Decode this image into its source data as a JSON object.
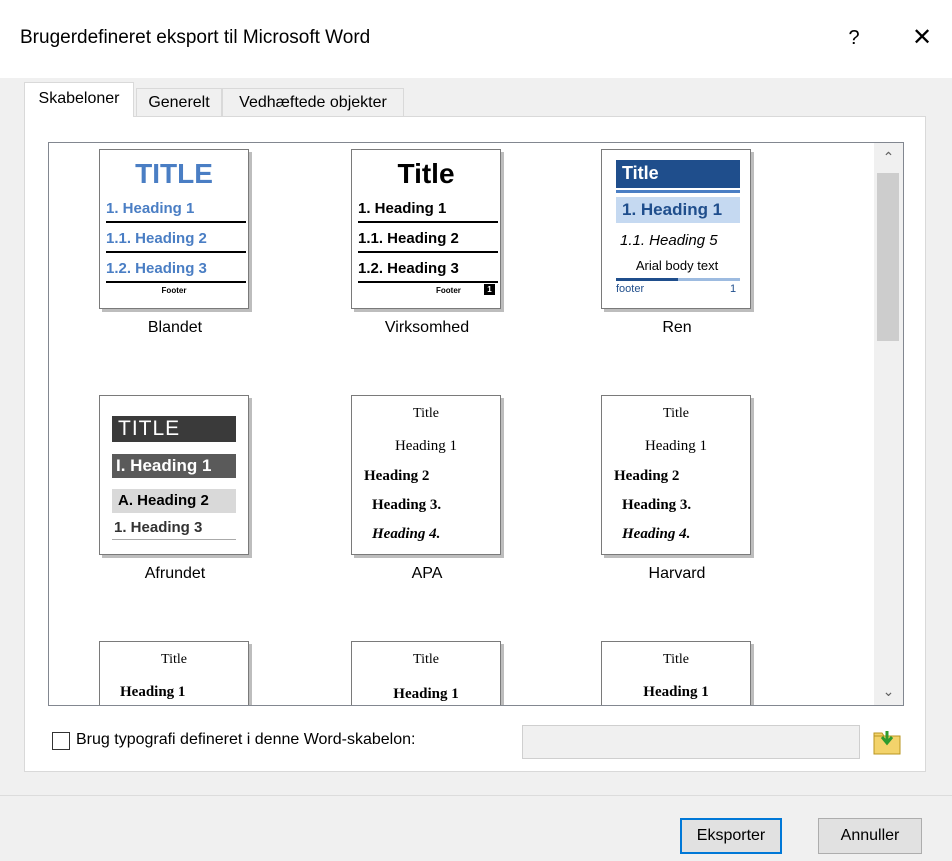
{
  "window": {
    "title": "Brugerdefineret eksport til Microsoft Word",
    "help": "?",
    "close": "✕"
  },
  "tabs": [
    "Skabeloner",
    "Generelt",
    "Vedhæftede objekter"
  ],
  "templates": [
    {
      "name": "Blandet",
      "title": "TITLE",
      "h1": "1. Heading 1",
      "h2": "1.1. Heading 2",
      "h3": "1.2. Heading 3",
      "footer": "Footer"
    },
    {
      "name": "Virksomhed",
      "title": "Title",
      "h1": "1. Heading 1",
      "h2": "1.1. Heading 2",
      "h3": "1.2. Heading 3",
      "footer": "Footer",
      "page": "1"
    },
    {
      "name": "Ren",
      "title": "Title",
      "h1": "1. Heading 1",
      "h5": "1.1. Heading 5",
      "body": "Arial body text",
      "footer": "footer",
      "page": "1"
    },
    {
      "name": "Afrundet",
      "title": "TITLE",
      "h1": "I. Heading 1",
      "h2": "A. Heading 2",
      "h3": "1. Heading 3"
    },
    {
      "name": "APA",
      "title": "Title",
      "h1": "Heading 1",
      "h2": "Heading 2",
      "h3": "Heading 3.",
      "h4": "Heading 4."
    },
    {
      "name": "Harvard",
      "title": "Title",
      "h1": "Heading 1",
      "h2": "Heading 2",
      "h3": "Heading 3.",
      "h4": "Heading 4."
    },
    {
      "title": "Title",
      "h1": "Heading 1"
    },
    {
      "title": "Title",
      "h1": "Heading 1"
    },
    {
      "title": "Title",
      "h1": "Heading 1"
    }
  ],
  "use_template_style": {
    "label": "Brug typografi defineret i denne Word-skabelon:",
    "checked": false,
    "path": ""
  },
  "buttons": {
    "export": "Eksporter",
    "cancel": "Annuller"
  },
  "icons": {
    "scroll_up": "⌃",
    "scroll_down": "⌄"
  },
  "colors": {
    "accent_blue": "#4a7ec4",
    "ren_header": "#1f4e8c",
    "ren_heading_bg": "#c5d9f1",
    "focus_border": "#0078d7"
  }
}
